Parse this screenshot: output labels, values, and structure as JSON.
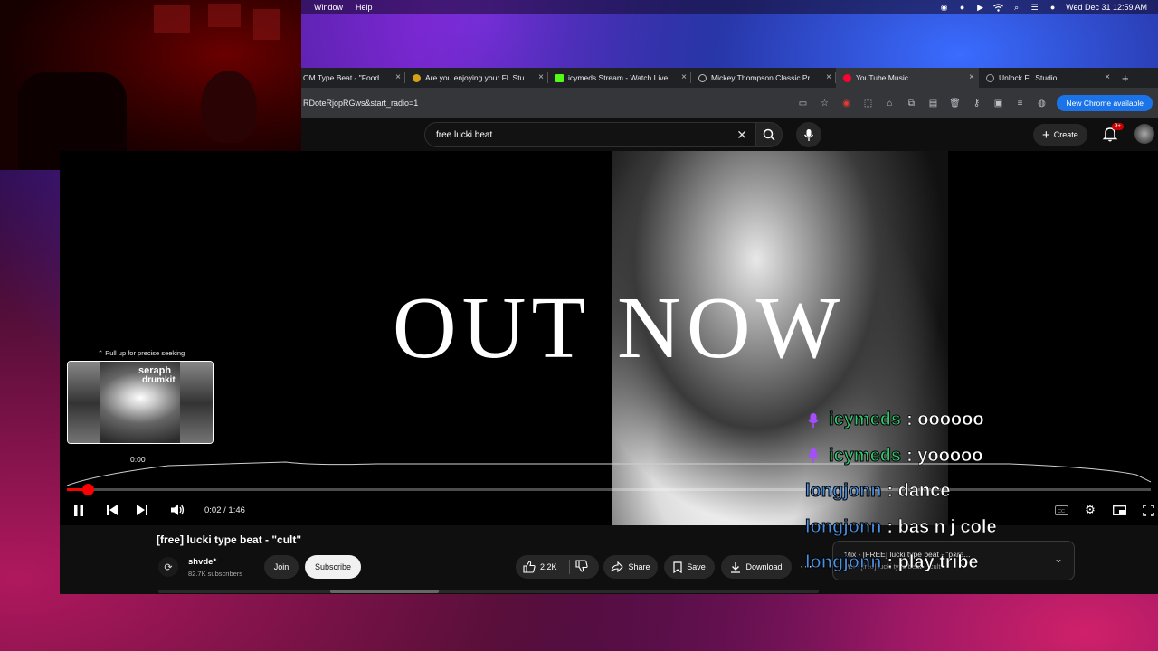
{
  "menubar": {
    "items": [
      "Window",
      "Help"
    ],
    "datetime": "Wed Dec 31  12:59 AM"
  },
  "browser": {
    "tabs": [
      {
        "label": "OM Type Beat - \"Food",
        "color": "#888888",
        "active": false
      },
      {
        "label": "Are you enjoying your FL Stu",
        "color": "#d4a017",
        "active": false
      },
      {
        "label": "icymeds Stream - Watch Live",
        "color": "#53fc18",
        "active": false
      },
      {
        "label": "Mickey Thompson Classic Pr",
        "color": "#bbbbbb",
        "active": false
      },
      {
        "label": "YouTube Music",
        "color": "#ff0033",
        "active": true
      },
      {
        "label": "Unlock FL Studio",
        "color": "#9aa0a6",
        "active": false
      }
    ],
    "url": "RDoteRjopRGws&start_radio=1",
    "update_button": "New Chrome available"
  },
  "youtube": {
    "search_value": "free lucki beat",
    "create_label": "Create",
    "notification_badge": "9+"
  },
  "player": {
    "overlay_text": "OUT NOW",
    "seek_hint": "Pull up for precise seeking",
    "preview_time": "0:00",
    "preview_text_1": "seraph",
    "preview_text_2": "drumkit",
    "time_current": "0:02",
    "time_total": "1:46",
    "time_display": "0:02 / 1:46",
    "progress_fraction": 0.019
  },
  "video": {
    "title": "[free] lucki type beat - \"cult\"",
    "channel_name": "shvde*",
    "subscribers": "82.7K subscribers",
    "join_label": "Join",
    "subscribe_label": "Subscribe",
    "likes": "2.2K",
    "share_label": "Share",
    "save_label": "Save",
    "download_label": "Download"
  },
  "playlist": {
    "line1": "Mix - [FREE] lucki type beat - \"para...",
    "line2": "Mix - [free] lucki type beat - \"cult\""
  },
  "chat": [
    {
      "user": "icymeds",
      "message": "oooooo",
      "color": "#2ecc71",
      "badge": true
    },
    {
      "user": "icymeds",
      "message": "yooooo",
      "color": "#2ecc71",
      "badge": true
    },
    {
      "user": "longjonn",
      "message": "dance",
      "color": "#4a90e2",
      "badge": false
    },
    {
      "user": "longjonn",
      "message": "bas n j cole",
      "color": "#4a90e2",
      "badge": false
    },
    {
      "user": "longjonn",
      "message": "play tribe",
      "color": "#4a90e2",
      "badge": false
    }
  ],
  "colors": {
    "accent": "#ff0000",
    "chrome_blue": "#1a73e8"
  }
}
